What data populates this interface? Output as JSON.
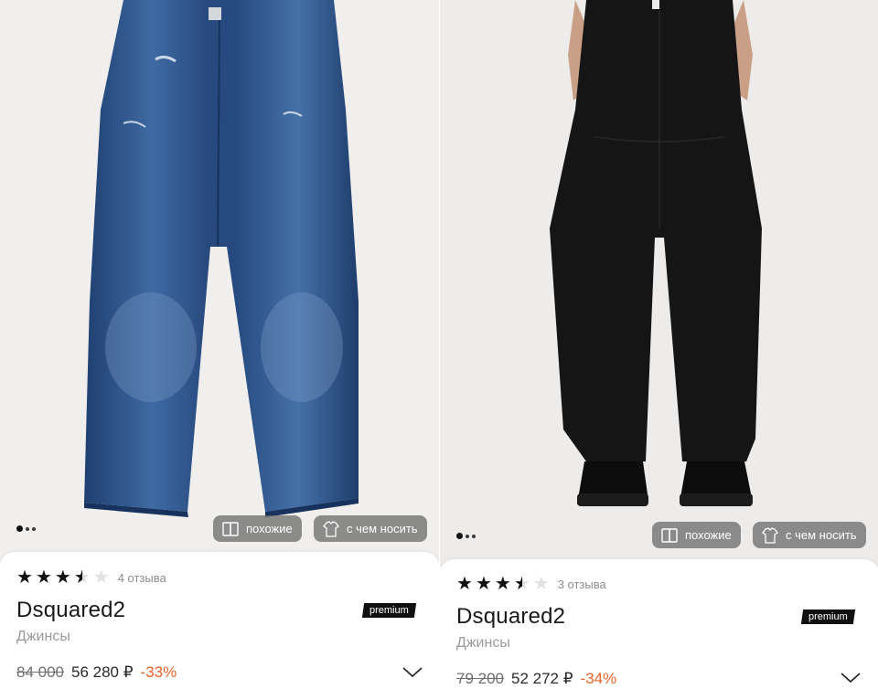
{
  "products": [
    {
      "photo_alt": "",
      "gallery_dots": 3,
      "chips": {
        "similar": "похожие",
        "outfit": "с чем носить"
      },
      "rating": 3.5,
      "reviews": "4 отзыва",
      "brand": "Dsquared2",
      "badge": "premium",
      "category": "Джинсы",
      "old_price": "84 000",
      "price": "56 280 ₽",
      "discount": "-33%"
    },
    {
      "photo_alt": "",
      "gallery_dots": 3,
      "chips": {
        "similar": "похожие",
        "outfit": "с чем носить"
      },
      "rating": 3.5,
      "reviews": "3 отзыва",
      "brand": "Dsquared2",
      "badge": "premium",
      "category": "Джинсы",
      "old_price": "79 200",
      "price": "52 272 ₽",
      "discount": "-34%"
    }
  ],
  "colors": {
    "discount": "#e8622a",
    "badge": "#111111",
    "denim": "#2f5a93",
    "black_pants": "#151515"
  },
  "icons": [
    "similar-icon",
    "outfit-icon",
    "expand-chevron-icon"
  ]
}
